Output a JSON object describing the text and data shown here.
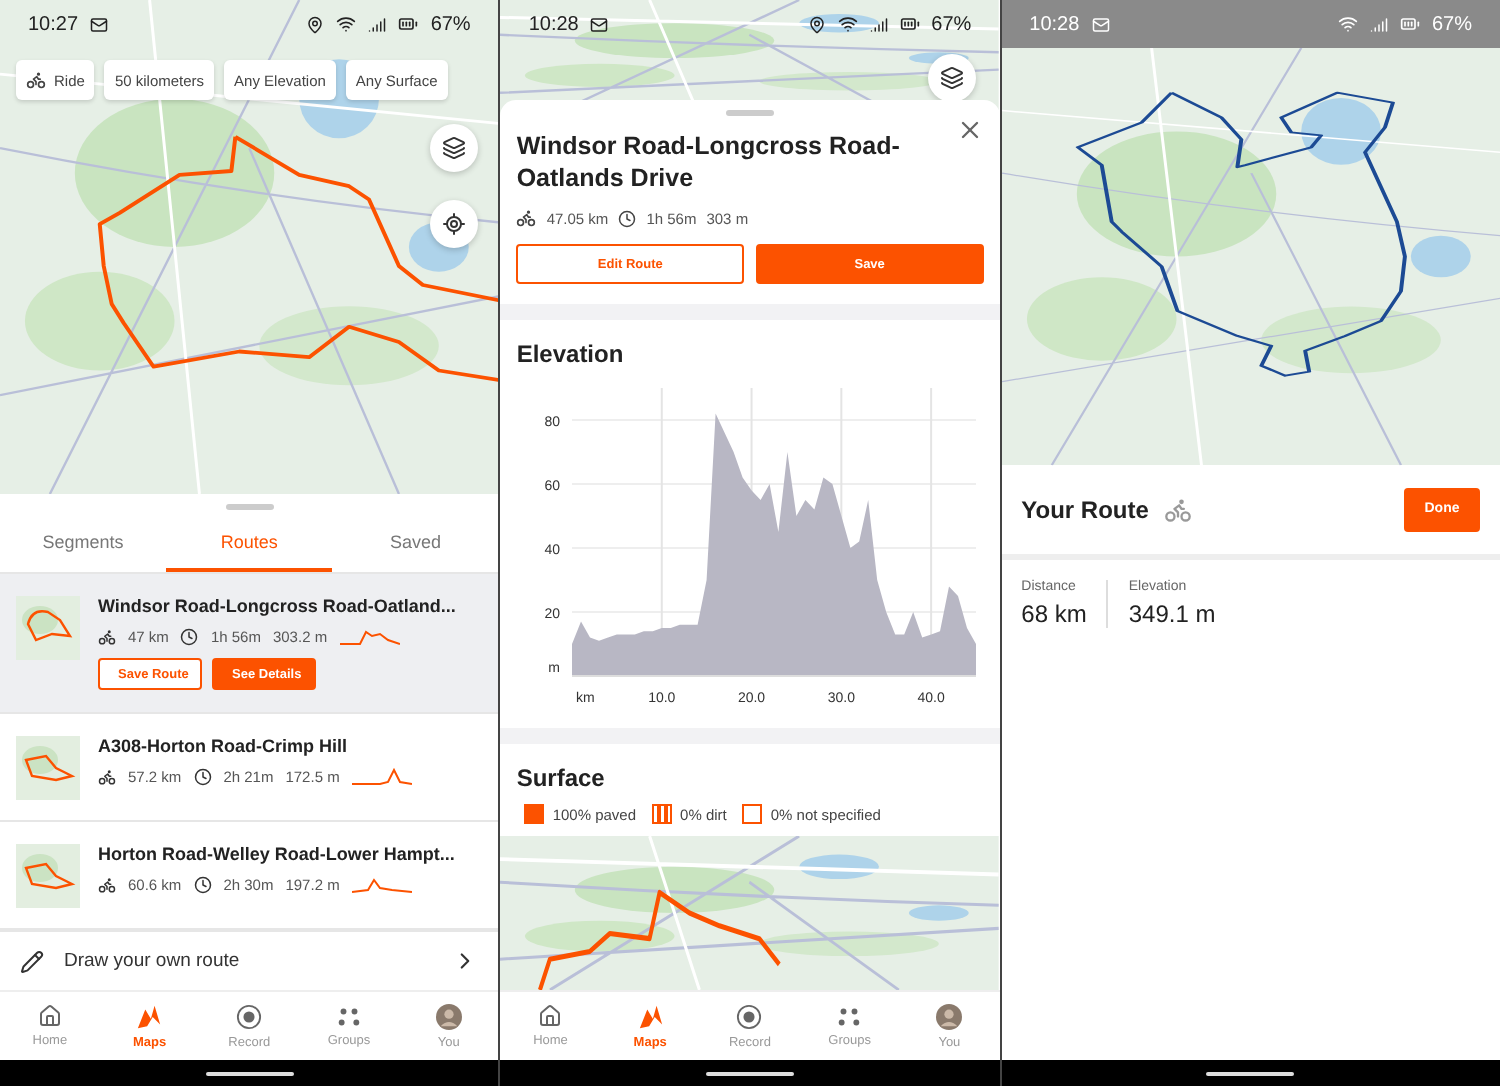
{
  "screens": [
    {
      "status_bar": {
        "time": "10:27",
        "battery": "67%",
        "location": true,
        "kind": "overlay"
      },
      "filters": [
        {
          "label": "Ride",
          "kind": "sport"
        },
        {
          "label": "50 kilometers",
          "kind": "option"
        },
        {
          "label": "Any Elevation",
          "kind": "option"
        },
        {
          "label": "Any Surface",
          "kind": "option"
        }
      ],
      "tabs": [
        {
          "label": "Segments",
          "selected": false
        },
        {
          "label": "Routes",
          "selected": true
        },
        {
          "label": "Saved",
          "selected": false
        }
      ],
      "routes": [
        {
          "name": "Windsor Road-Longcross Road-Oatland...",
          "distance": "47 km",
          "time": "1h 56m",
          "elevation": "303.2 m",
          "selected": true,
          "actions": [
            {
              "label": "Save Route",
              "primary": false
            },
            {
              "label": "See Details",
              "primary": true
            }
          ]
        },
        {
          "name": "A308-Horton Road-Crimp Hill",
          "distance": "57.2 km",
          "time": "2h 21m",
          "elevation": "172.5 m",
          "selected": false
        },
        {
          "name": "Horton Road-Welley Road-Lower Hampt...",
          "distance": "60.6 km",
          "time": "2h 30m",
          "elevation": "197.2 m",
          "selected": false
        }
      ],
      "draw_route": "Draw your own route",
      "nav": [
        {
          "label": "Home",
          "kind": "home",
          "selected": false
        },
        {
          "label": "Maps",
          "kind": "maps",
          "selected": true
        },
        {
          "label": "Record",
          "kind": "record",
          "selected": false
        },
        {
          "label": "Groups",
          "kind": "groups",
          "selected": false
        },
        {
          "label": "You",
          "kind": "profile",
          "selected": false
        }
      ]
    },
    {
      "status_bar": {
        "time": "10:28",
        "battery": "67%",
        "location": true,
        "kind": "overlay"
      },
      "title": "Windsor Road-Longcross Road-Oatlands Drive",
      "stats": {
        "distance": "47.05 km",
        "time": "1h 56m",
        "elevation": "303 m"
      },
      "buttons": [
        {
          "label": "Edit Route",
          "primary": false
        },
        {
          "label": "Save",
          "primary": true
        }
      ],
      "elevation": {
        "chart_data": {
          "type": "area",
          "title": "Elevation",
          "xlabel": "km",
          "ylabel": "m",
          "xlim": [
            0,
            45
          ],
          "ylim": [
            0,
            90
          ],
          "x": [
            0,
            1,
            2,
            3,
            4,
            5,
            6,
            7,
            8,
            9,
            10,
            11,
            12,
            13,
            14,
            15,
            16,
            17,
            18,
            19,
            20,
            21,
            22,
            23,
            24,
            25,
            26,
            27,
            28,
            29,
            30,
            31,
            32,
            33,
            34,
            35,
            36,
            37,
            38,
            39,
            40,
            41,
            42,
            43,
            44,
            45
          ],
          "values": [
            10,
            17,
            12,
            11,
            12,
            13,
            13,
            13,
            14,
            14,
            15,
            15,
            16,
            16,
            16,
            30,
            82,
            76,
            70,
            62,
            58,
            55,
            60,
            45,
            70,
            50,
            55,
            52,
            62,
            60,
            50,
            40,
            42,
            55,
            30,
            20,
            13,
            13,
            20,
            12,
            13,
            14,
            28,
            25,
            15,
            10
          ],
          "xticks": [
            {
              "value": 10,
              "label": "10.0"
            },
            {
              "value": 20,
              "label": "20.0"
            },
            {
              "value": 30,
              "label": "30.0"
            },
            {
              "value": 40,
              "label": "40.0"
            }
          ],
          "yticks": [
            20,
            40,
            60,
            80
          ],
          "grid": true
        }
      },
      "surface": {
        "title": "Surface",
        "legend": [
          {
            "label": "100% paved",
            "kind": "solid"
          },
          {
            "label": "0% dirt",
            "kind": "striped"
          },
          {
            "label": "0% not specified",
            "kind": "outline"
          }
        ]
      },
      "nav": [
        {
          "label": "Home",
          "kind": "home",
          "selected": false
        },
        {
          "label": "Maps",
          "kind": "maps",
          "selected": true
        },
        {
          "label": "Record",
          "kind": "record",
          "selected": false
        },
        {
          "label": "Groups",
          "kind": "groups",
          "selected": false
        },
        {
          "label": "You",
          "kind": "profile",
          "selected": false
        }
      ]
    },
    {
      "status_bar": {
        "time": "10:28",
        "battery": "67%",
        "location": false,
        "kind": "solid"
      },
      "title": "Your Route",
      "done": "Done",
      "stats": [
        {
          "label": "Distance",
          "value": "68 km"
        },
        {
          "label": "Elevation",
          "value": "349.1 m"
        }
      ]
    }
  ]
}
